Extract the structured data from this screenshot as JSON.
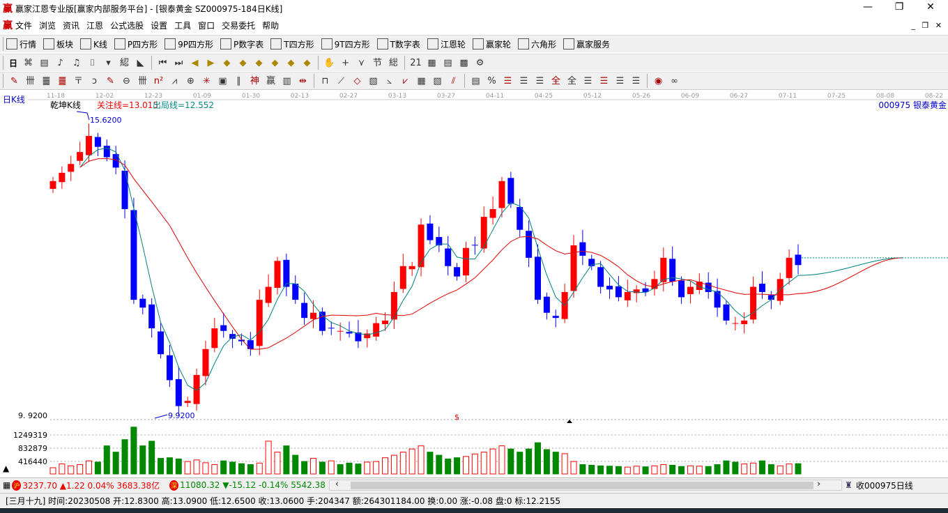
{
  "window": {
    "title": "赢家江恩专业版[赢家内部服务平台] - [银泰黄金  SZ000975-184日K线]",
    "logo": "赢"
  },
  "menu": [
    "文件",
    "浏览",
    "资讯",
    "江恩",
    "公式选股",
    "设置",
    "工具",
    "窗口",
    "交易委托",
    "帮助"
  ],
  "toolbar1": [
    {
      "icon": "grid-icon",
      "label": "行情"
    },
    {
      "icon": "blocks-icon",
      "label": "板块"
    },
    {
      "icon": "candles-icon",
      "label": "K线"
    },
    {
      "icon": "PS",
      "label": "P四方形"
    },
    {
      "icon": "P9",
      "label": "9P四方形"
    },
    {
      "icon": "PN",
      "label": "P数字表"
    },
    {
      "icon": "TS",
      "label": "T四方形"
    },
    {
      "icon": "T9",
      "label": "9T四方形"
    },
    {
      "icon": "TN",
      "label": "T数字表"
    },
    {
      "icon": "wheel-icon",
      "label": "江恩轮"
    },
    {
      "icon": "wheel-icon",
      "label": "赢家轮"
    },
    {
      "icon": "hexagon-icon",
      "label": "六角形"
    },
    {
      "icon": "dollar-icon",
      "label": "赢家服务"
    }
  ],
  "toolbar2": {
    "period": "日",
    "glyphs": [
      "⌘",
      "▤",
      "♪",
      "♫",
      "⌷",
      "▾",
      "綛",
      "◣",
      "⏮",
      "⏭",
      "◀",
      "▶",
      "◆",
      "◆",
      "◆",
      "◆",
      "◆",
      "◆",
      "✋",
      "+",
      "⋎",
      "节",
      "総",
      "21",
      "▦",
      "▤",
      "▩",
      "⚙"
    ]
  },
  "toolbar3": {
    "glyphs": [
      "✎",
      "卌",
      "䷀",
      "䷀",
      "〒",
      "ↄ",
      "✎",
      "⊖",
      "卌",
      "n²",
      "⩘",
      "⊕",
      "✳",
      "▣",
      "∥",
      "神",
      "赢",
      "▥",
      "⇹",
      "⊓",
      "⟋",
      "◇",
      "▧",
      "⦣",
      "⩗",
      "▦",
      "▧",
      "⫽",
      "▤",
      "%",
      "☰",
      "☰",
      "☰",
      "全",
      "全",
      "☰",
      "☰",
      "☰",
      "☰",
      "◉",
      "∞"
    ]
  },
  "chart": {
    "period_label": "日K线",
    "indicator_name": "乾坤K线",
    "focus_line": "关注线=13.015",
    "exit_line": "出局线=12.552",
    "stock": "000975  银泰黄金",
    "high_label": "15.6200",
    "low_label": "9.9200",
    "price_axis_low": "9. 9200",
    "dollar_marker": "$",
    "dates": [
      "11-18",
      "12-02",
      "12-23",
      "01-09",
      "01-30",
      "02-13",
      "02-27",
      "03-13",
      "03-27",
      "04-11",
      "04-25",
      "05-12",
      "05-26",
      "06-09",
      "06-27",
      "07-11",
      "07-25",
      "08-08",
      "08-22"
    ],
    "vol_ticks": [
      "1249319",
      "832879",
      "416440"
    ],
    "vol_scale_max": 1500000,
    "price_range": [
      9.92,
      15.62
    ],
    "closes": [
      14.44,
      14.6,
      14.77,
      15.0,
      15.31,
      15.1,
      14.9,
      14.7,
      13.9,
      12.15,
      12.0,
      11.6,
      11.1,
      10.6,
      10.1,
      10.2,
      10.7,
      11.2,
      11.6,
      11.55,
      11.4,
      11.35,
      11.2,
      12.15,
      12.4,
      12.9,
      12.4,
      12.15,
      11.8,
      11.9,
      11.55,
      11.6,
      11.55,
      11.5,
      11.35,
      11.5,
      11.7,
      11.75,
      12.3,
      12.8,
      12.8,
      13.6,
      13.3,
      13.2,
      12.8,
      12.6,
      13.15,
      13.2,
      13.75,
      13.9,
      14.44,
      14.0,
      13.5,
      12.96,
      12.15,
      11.9,
      11.8,
      12.3,
      13.2,
      13.0,
      12.8,
      12.4,
      12.35,
      12.2,
      12.3,
      12.35,
      12.3,
      12.55,
      12.96,
      12.5,
      12.2,
      12.4,
      12.5,
      12.3,
      12.0,
      11.75,
      11.7,
      11.75,
      12.4,
      12.3,
      12.15,
      12.55,
      12.96,
      12.82
    ],
    "volumes": [
      200000,
      320000,
      260000,
      300000,
      420000,
      380000,
      900000,
      700000,
      1100000,
      1500000,
      900000,
      1050000,
      500000,
      520000,
      480000,
      400000,
      450000,
      360000,
      300000,
      420000,
      380000,
      330000,
      300000,
      350000,
      1050000,
      700000,
      900000,
      600000,
      400000,
      500000,
      380000,
      420000,
      300000,
      350000,
      320000,
      380000,
      400000,
      520000,
      600000,
      700000,
      800000,
      900000,
      700000,
      600000,
      480000,
      520000,
      560000,
      640000,
      700000,
      800000,
      900000,
      800000,
      700000,
      800000,
      1000000,
      780000,
      700000,
      650000,
      400000,
      300000,
      280000,
      260000,
      250000,
      240000,
      220000,
      250000,
      230000,
      260000,
      300000,
      280000,
      240000,
      260000,
      250000,
      240000,
      300000,
      420000,
      380000,
      320000,
      350000,
      420000,
      300000,
      260000,
      320000,
      330000
    ]
  },
  "status": {
    "sh": "3237.70 ▲1.22 0.04% 3683.38亿",
    "sh_badge": "沪",
    "sz": "11080.32 ▼-15.12 -0.14% 5542.38",
    "sz_badge": "深",
    "right": "收000975日线",
    "left_arrow": "‹",
    "right_arrow": "›"
  },
  "info": "[三月十九] 时间:20230508 开:12.8300 高:13.0900 低:12.6500 收:13.0600 手:204347 额:264301184.00 换:0.00 涨:-0.08 盘:0 标:12.2155",
  "colors": {
    "up": "#ff0000",
    "down": "#0000ff",
    "ma_short": "#008080",
    "ma_long": "#e00000",
    "vol_down": "#008800"
  }
}
